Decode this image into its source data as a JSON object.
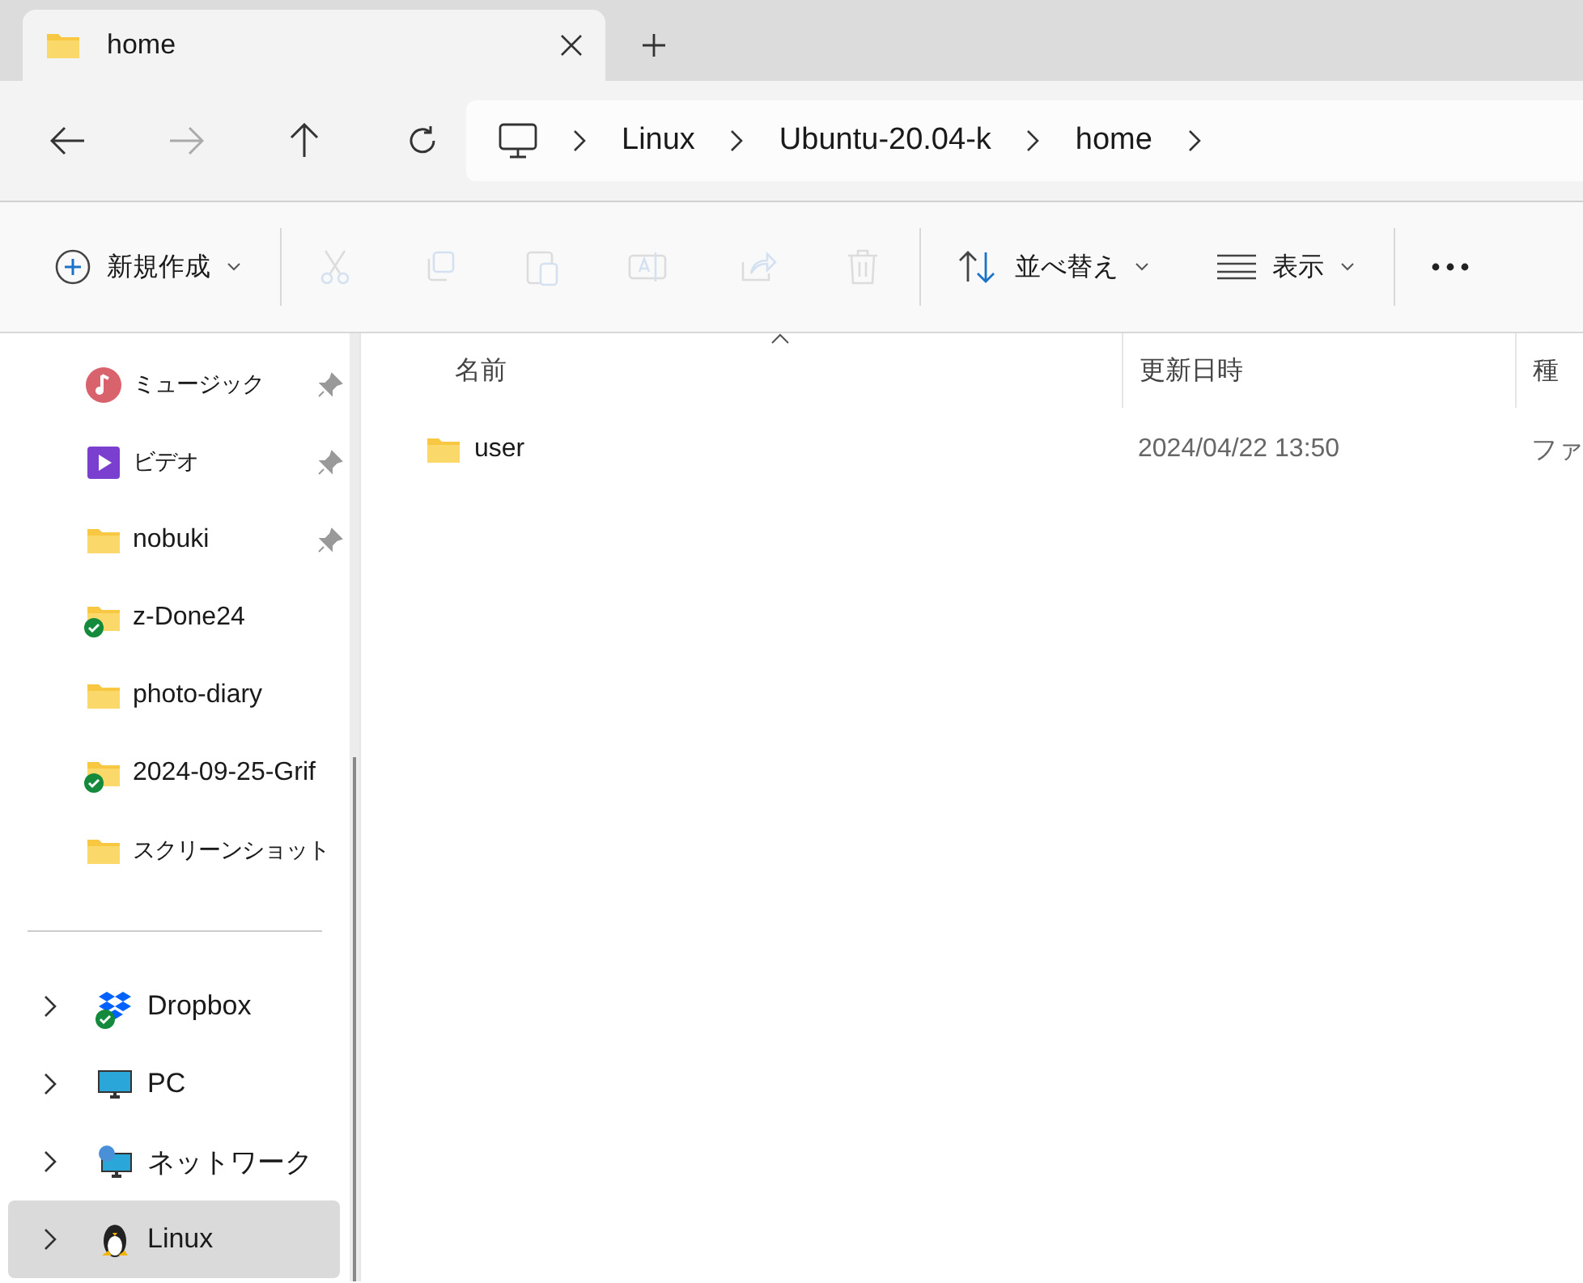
{
  "tab": {
    "title": "home"
  },
  "navigation": {
    "back": {
      "disabled": false
    },
    "forward": {
      "disabled": true
    }
  },
  "breadcrumb": [
    "Linux",
    "Ubuntu-20.04-k",
    "home"
  ],
  "toolbar": [
    {
      "kind": "new",
      "label": "新規作成",
      "disabled": false
    },
    {
      "kind": "cut",
      "disabled": true
    },
    {
      "kind": "copy",
      "disabled": true
    },
    {
      "kind": "paste",
      "disabled": true
    },
    {
      "kind": "rename",
      "disabled": true
    },
    {
      "kind": "share",
      "disabled": true
    },
    {
      "kind": "delete",
      "disabled": true
    },
    {
      "kind": "sort",
      "label": "並べ替え",
      "disabled": false
    },
    {
      "kind": "view",
      "label": "表示",
      "disabled": false
    },
    {
      "kind": "more",
      "disabled": false
    }
  ],
  "sidebar": {
    "pinned": [
      {
        "label": "ミュージック",
        "kind": "music",
        "pinned": true,
        "synced": false
      },
      {
        "label": "ビデオ",
        "kind": "video",
        "pinned": true,
        "synced": false
      },
      {
        "label": "nobuki",
        "kind": "folder",
        "pinned": true,
        "synced": false
      },
      {
        "label": "z-Done24",
        "kind": "folder",
        "pinned": false,
        "synced": true
      },
      {
        "label": "photo-diary",
        "kind": "folder",
        "pinned": false,
        "synced": false
      },
      {
        "label": "2024-09-25-Grif",
        "kind": "folder",
        "pinned": false,
        "synced": true
      },
      {
        "label": "スクリーンショット",
        "kind": "folder",
        "pinned": false,
        "synced": false
      }
    ],
    "tree": [
      {
        "label": "Dropbox",
        "kind": "dropbox",
        "synced": true,
        "selected": false
      },
      {
        "label": "PC",
        "kind": "pc",
        "synced": false,
        "selected": false
      },
      {
        "label": "ネットワーク",
        "kind": "network",
        "synced": false,
        "selected": false
      },
      {
        "label": "Linux",
        "kind": "linux",
        "synced": false,
        "selected": true
      }
    ]
  },
  "table": {
    "columns": [
      "名前",
      "更新日時",
      "種"
    ],
    "rows": [
      {
        "name": "user",
        "modified": "2024/04/22 13:50",
        "type": "ファ"
      }
    ]
  }
}
